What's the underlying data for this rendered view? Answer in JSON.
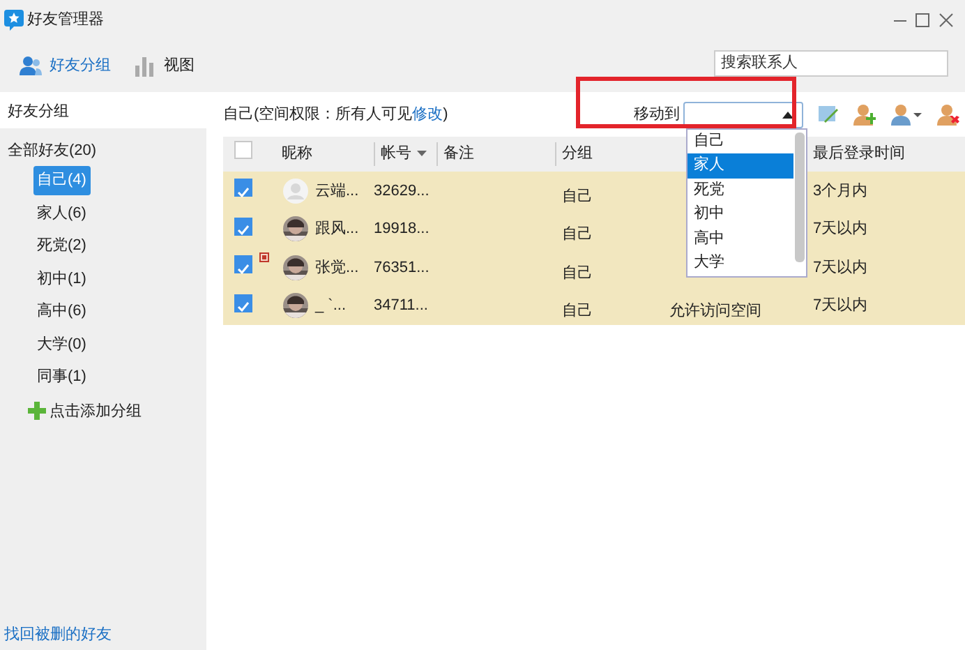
{
  "window": {
    "title": "好友管理器"
  },
  "toolbar": [
    {
      "label": "好友分组",
      "selected": true
    },
    {
      "label": "视图",
      "selected": false
    }
  ],
  "search": {
    "placeholder": "搜索联系人"
  },
  "sidebar": {
    "title": "好友分组",
    "groups": [
      {
        "label": "全部好友(20)",
        "expanded": true,
        "children": [
          {
            "label": "自己(4)",
            "selected": true
          },
          {
            "label": "家人(6)",
            "selected": false
          },
          {
            "label": "死党(2)",
            "selected": false
          },
          {
            "label": "初中(1)",
            "selected": false
          },
          {
            "label": "高中(6)",
            "selected": false
          },
          {
            "label": "大学(0)",
            "selected": false
          },
          {
            "label": "同事(1)",
            "selected": false
          }
        ]
      }
    ],
    "add_group": "点击添加分组",
    "footer_link": "找回被删的好友"
  },
  "group_info": {
    "text": "自己(空间权限：所有人可见",
    "link": "修改",
    "end": ")"
  },
  "move_to": {
    "label": "移动到",
    "expanded": true,
    "options": [
      {
        "label": "自己",
        "selected": false
      },
      {
        "label": "家人",
        "selected": true
      },
      {
        "label": "死党",
        "selected": false
      },
      {
        "label": "初中",
        "selected": false
      },
      {
        "label": "高中",
        "selected": false
      },
      {
        "label": "大学",
        "selected": false
      }
    ]
  },
  "table": {
    "all_checked": false,
    "columns": [
      {
        "label": "昵称"
      },
      {
        "label": "帐号",
        "sorted": true
      },
      {
        "label": "备注"
      },
      {
        "label": "分组"
      },
      {
        "label": "最后登录时间"
      }
    ],
    "rows": [
      {
        "checked": true,
        "avatar": {
          "kind": "default"
        },
        "marked": false,
        "nickname": "云端...",
        "account": "32629...",
        "group": "自己",
        "last_login": "3个月内"
      },
      {
        "checked": true,
        "marked": false,
        "nickname": "跟风...",
        "account": "19918...",
        "group": "自己",
        "last_login": "7天以内"
      },
      {
        "checked": true,
        "marked": true,
        "nickname": "张觉...",
        "account": "76351...",
        "group": "自己",
        "last_login": "7天以内"
      },
      {
        "checked": true,
        "marked": false,
        "nickname": "_ `...",
        "account": "34711...",
        "group": "自己",
        "column_6": "允许访问空间",
        "last_login": "7天以内"
      }
    ]
  }
}
